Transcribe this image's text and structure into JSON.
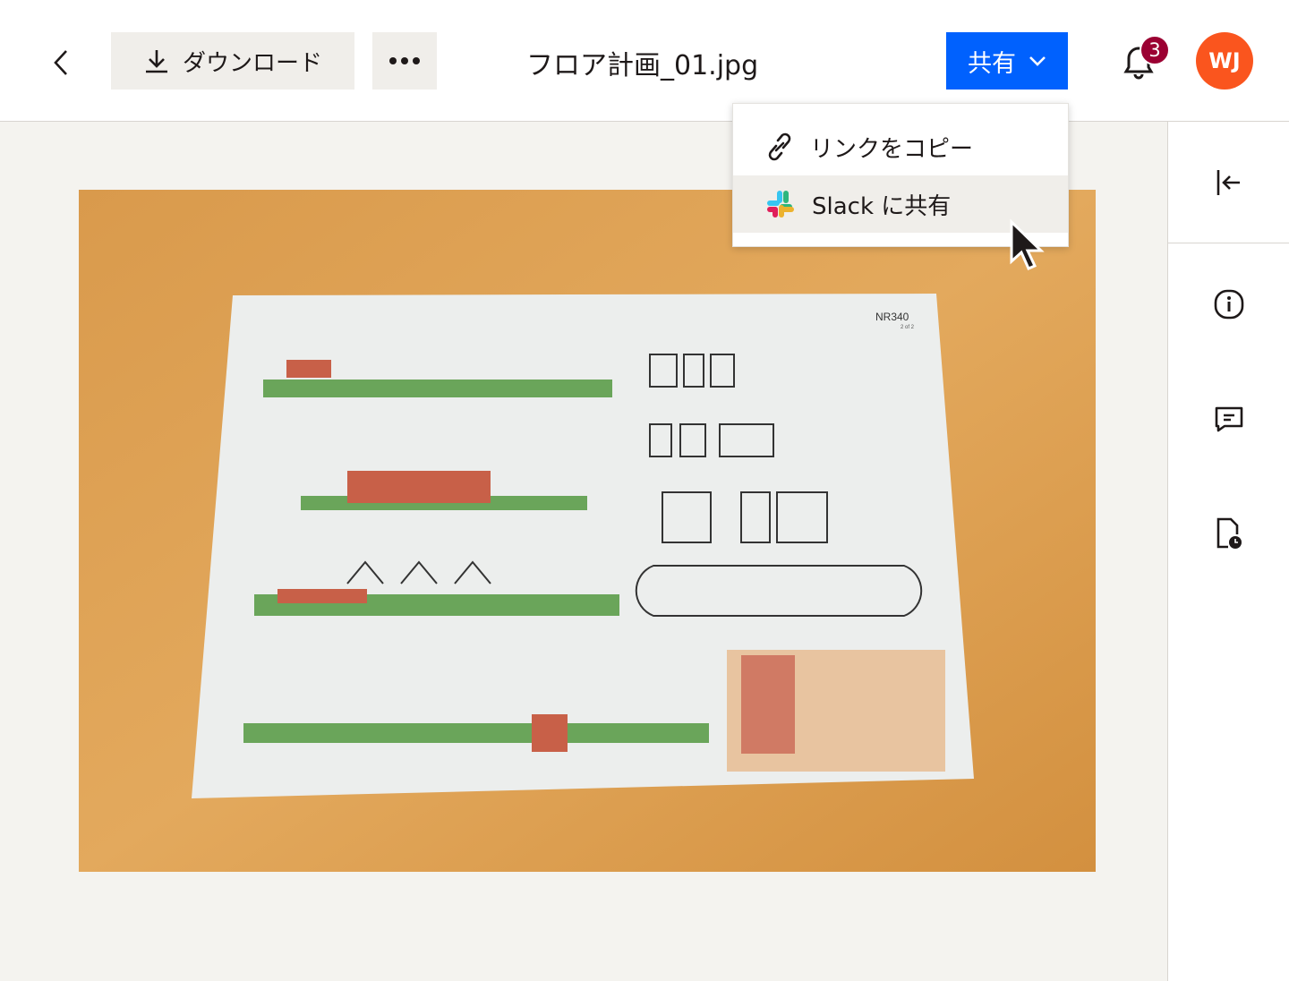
{
  "header": {
    "back_icon": "chevron-left-icon",
    "download_label": "ダウンロード",
    "more_icon": "ellipsis-icon",
    "file_name": "フロア計画_01.jpg",
    "share_label": "共有",
    "notification_count": "3",
    "avatar_initials": "WJ",
    "colors": {
      "share": "#0061fe",
      "badge": "#9b0032",
      "avatar": "#fa551e"
    }
  },
  "share_menu": {
    "items": [
      {
        "label": "リンクをコピー",
        "icon": "link-icon"
      },
      {
        "label": "Slack に共有",
        "icon": "slack-icon"
      }
    ]
  },
  "sidebar": {
    "icons": [
      "collapse-panel-icon",
      "info-icon",
      "comment-icon",
      "file-history-icon"
    ]
  },
  "preview": {
    "sheet_code": "NR340",
    "sheet_page": "2 of 2"
  }
}
